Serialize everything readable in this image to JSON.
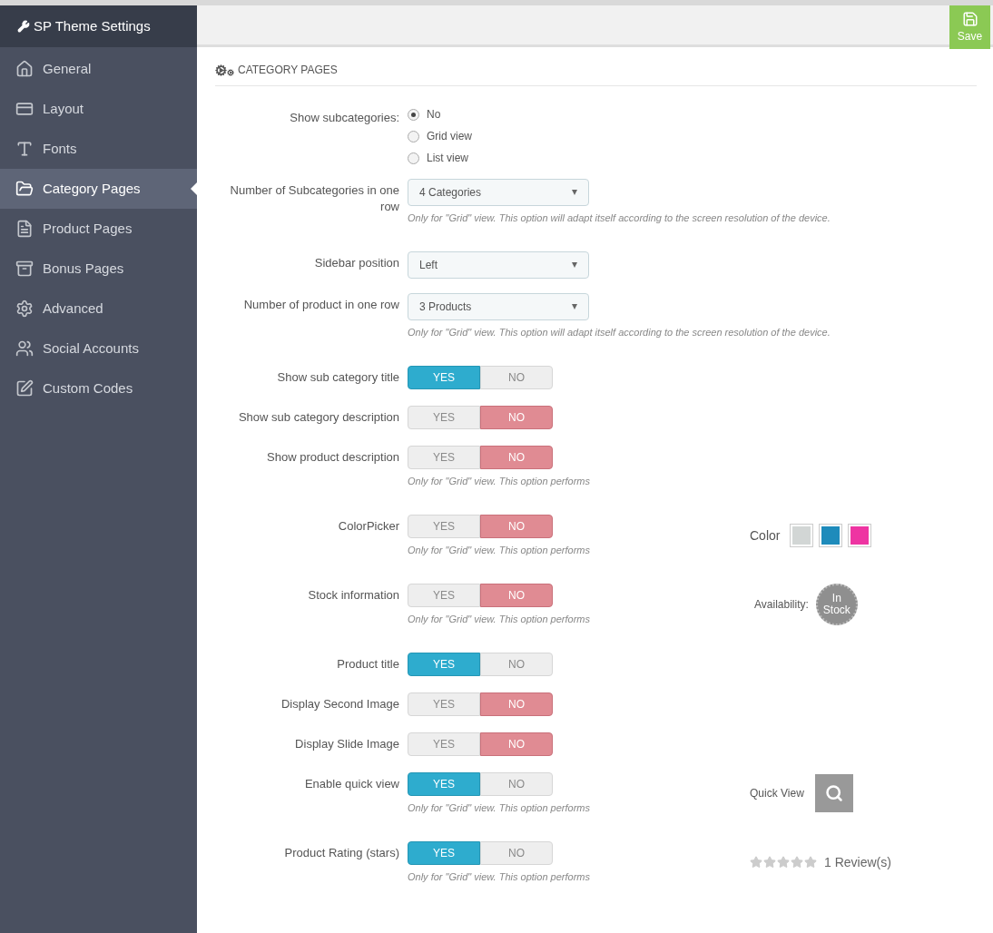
{
  "sidebar": {
    "title": "SP Theme Settings",
    "items": [
      {
        "label": "General",
        "selected": false
      },
      {
        "label": "Layout",
        "selected": false
      },
      {
        "label": "Fonts",
        "selected": false
      },
      {
        "label": "Category Pages",
        "selected": true
      },
      {
        "label": "Product Pages",
        "selected": false
      },
      {
        "label": "Bonus Pages",
        "selected": false
      },
      {
        "label": "Advanced",
        "selected": false
      },
      {
        "label": "Social Accounts",
        "selected": false
      },
      {
        "label": "Custom Codes",
        "selected": false
      }
    ]
  },
  "toolbar": {
    "save_label": "Save"
  },
  "section": {
    "title": "CATEGORY PAGES"
  },
  "fields": [
    {
      "kind": "radio",
      "label": "Show subcategories:",
      "options": [
        {
          "label": "No",
          "selected": true
        },
        {
          "label": "Grid view",
          "selected": false
        },
        {
          "label": "List view",
          "selected": false
        }
      ]
    },
    {
      "kind": "select",
      "label": "Number of Subcategories in one row",
      "value": "4 Categories",
      "hint": "Only for \"Grid\" view. This option will adapt itself according to the screen resolution of the device."
    },
    {
      "kind": "select",
      "label": "Sidebar position",
      "value": "Left"
    },
    {
      "kind": "select",
      "label": "Number of product in one row",
      "value": "3 Products",
      "hint": "Only for \"Grid\" view. This option will adapt itself according to the screen resolution of the device."
    },
    {
      "kind": "toggle",
      "label": "Show sub category title",
      "yes": "YES",
      "no": "NO",
      "on": true
    },
    {
      "kind": "toggle",
      "label": "Show sub category description",
      "yes": "YES",
      "no": "NO",
      "on": false
    },
    {
      "kind": "toggle",
      "label": "Show product description",
      "yes": "YES",
      "no": "NO",
      "on": false,
      "hint": "Only for \"Grid\" view. This option performs"
    },
    {
      "kind": "toggle",
      "label": "ColorPicker",
      "yes": "YES",
      "no": "NO",
      "on": false,
      "hint": "Only for \"Grid\" view. This option performs",
      "preview": {
        "kind": "colors",
        "label": "Color",
        "swatches": [
          {
            "color": "#d2d6d5"
          },
          {
            "color": "#1e8bbb"
          },
          {
            "color": "#ee34a2"
          }
        ]
      }
    },
    {
      "kind": "toggle",
      "label": "Stock information",
      "yes": "YES",
      "no": "NO",
      "on": false,
      "hint": "Only for \"Grid\" view. This option performs",
      "preview": {
        "kind": "availability",
        "label": "Availability:",
        "badge": "In Stock"
      }
    },
    {
      "kind": "toggle",
      "label": "Product title",
      "yes": "YES",
      "no": "NO",
      "on": true
    },
    {
      "kind": "toggle",
      "label": "Display Second Image",
      "yes": "YES",
      "no": "NO",
      "on": false
    },
    {
      "kind": "toggle",
      "label": "Display Slide Image",
      "yes": "YES",
      "no": "NO",
      "on": false
    },
    {
      "kind": "toggle",
      "label": "Enable quick view",
      "yes": "YES",
      "no": "NO",
      "on": true,
      "hint": "Only for \"Grid\" view. This option performs",
      "preview": {
        "kind": "quickview",
        "label": "Quick View"
      }
    },
    {
      "kind": "toggle",
      "label": "Product Rating (stars)",
      "yes": "YES",
      "no": "NO",
      "on": true,
      "hint": "Only for \"Grid\" view. This option performs",
      "preview": {
        "kind": "rating",
        "stars": 0,
        "label": "1 Review(s)"
      }
    }
  ]
}
